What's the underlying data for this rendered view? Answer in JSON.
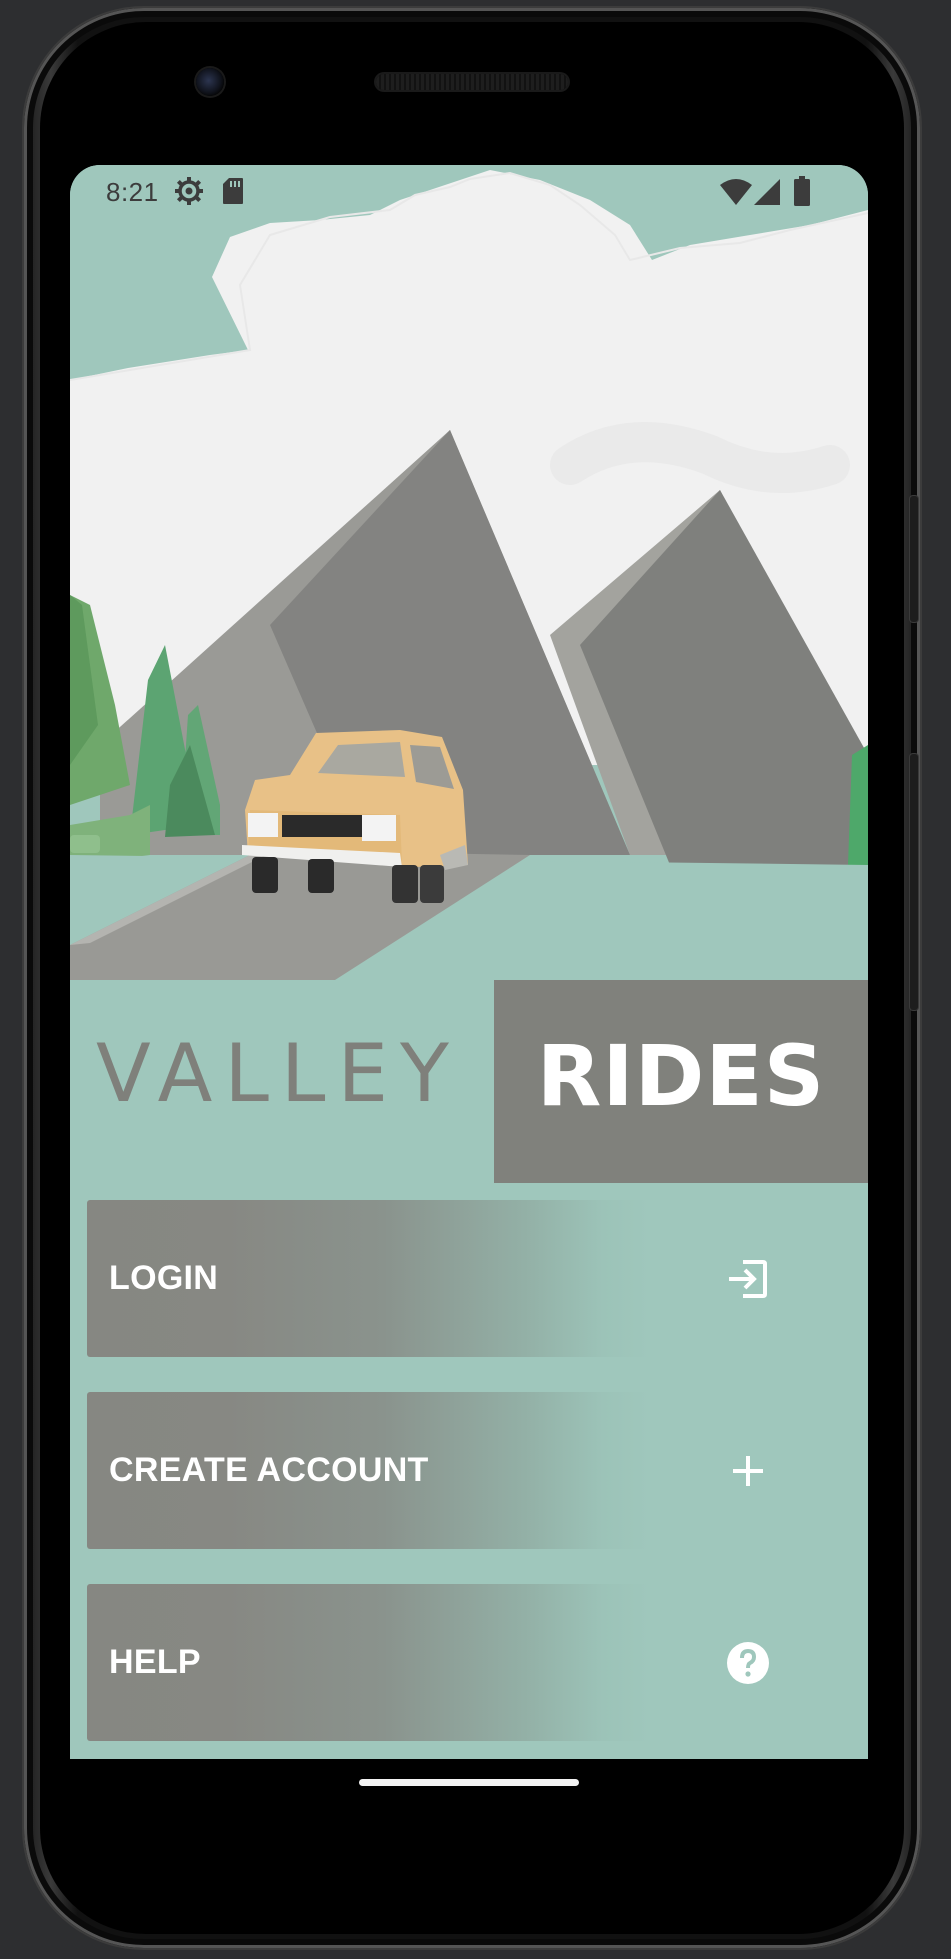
{
  "status_bar": {
    "time": "8:21",
    "icons": [
      "gear-icon",
      "sd-card-icon",
      "wifi-icon",
      "cell-signal-icon",
      "battery-icon"
    ]
  },
  "hero": {
    "image": "low-poly illustration of car on road with mountains and trees"
  },
  "title": {
    "valley": "VALLEY",
    "rides": "RIDES"
  },
  "menu": {
    "items": [
      {
        "label": "LOGIN",
        "icon": "login-icon"
      },
      {
        "label": "CREATE ACCOUNT",
        "icon": "plus-icon"
      },
      {
        "label": "HELP",
        "icon": "help-icon"
      }
    ]
  },
  "colors": {
    "background_teal": "#9fc7bc",
    "gray_accent": "#80817c",
    "text_gray": "#7f807b",
    "white": "#ffffff"
  }
}
